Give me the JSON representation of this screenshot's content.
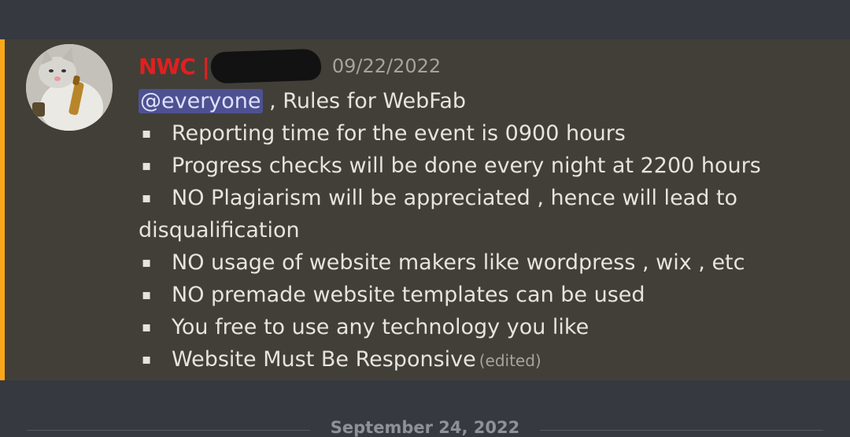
{
  "message": {
    "author": "NWC |",
    "timestamp": "09/22/2022",
    "mention": "@everyone",
    "title_rest": " , Rules for WebFab",
    "bullet_glyph": "▪",
    "bullets": [
      "Reporting time for the event is 0900 hours",
      "Progress checks will be done every night at 2200 hours",
      "NO Plagiarism will be appreciated , hence will lead to",
      "NO usage of website makers like wordpress , wix , etc",
      "NO premade website templates can be used",
      "You free to use any technology you like",
      "Website Must Be Responsive"
    ],
    "continuation": "disqualification",
    "edited_label": "(edited)"
  },
  "divider": {
    "date": "September 24, 2022"
  },
  "colors": {
    "background": "#36393f",
    "highlight": "#413f38",
    "mention_bar": "#faa81a",
    "username": "#e02020",
    "mention_bg": "#4d5191"
  }
}
